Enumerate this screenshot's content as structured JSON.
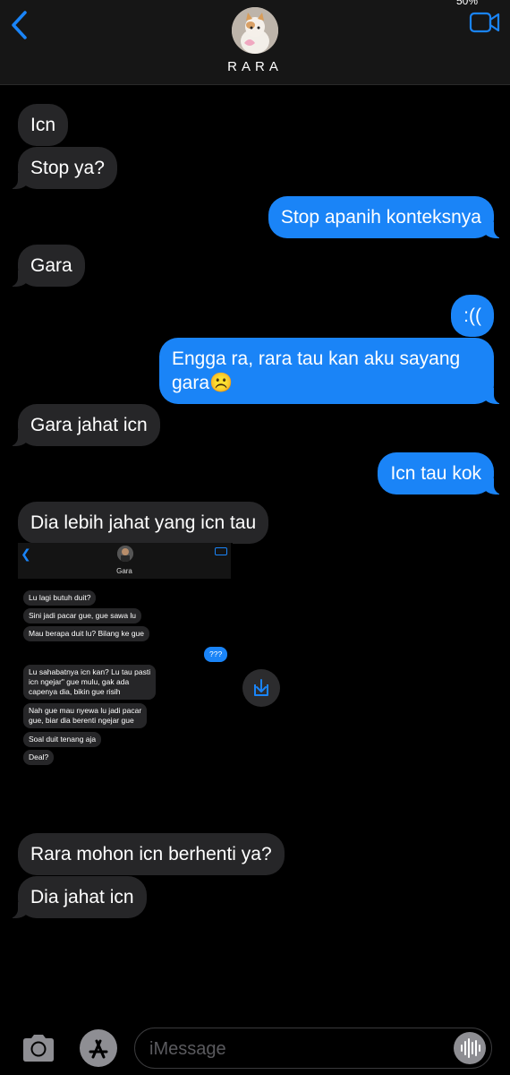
{
  "header": {
    "status_partial": "50%",
    "contact_name": "RARA",
    "back_icon": "chevron-left-icon",
    "video_icon": "video-camera-icon"
  },
  "messages": [
    {
      "dir": "in",
      "text": "Icn"
    },
    {
      "dir": "in",
      "text": "Stop ya?"
    },
    {
      "dir": "out",
      "text": "Stop apanih konteksnya"
    },
    {
      "dir": "in",
      "text": "Gara"
    },
    {
      "dir": "out",
      "text": ":(("
    },
    {
      "dir": "out",
      "text": "Engga ra, rara tau kan aku sayang gara☹️"
    },
    {
      "dir": "in",
      "text": "Gara jahat icn"
    },
    {
      "dir": "out",
      "text": "Icn tau kok"
    },
    {
      "dir": "in",
      "text": "Dia lebih jahat yang icn tau"
    },
    {
      "dir": "in",
      "text": "Rara mohon icn berhenti ya?"
    },
    {
      "dir": "in",
      "text": "Dia jahat icn"
    }
  ],
  "attachment": {
    "contact_name": "Gara",
    "messages": [
      {
        "dir": "in",
        "text": "Lu lagi butuh duit?"
      },
      {
        "dir": "in",
        "text": "Sini jadi pacar gue, gue sawa lu"
      },
      {
        "dir": "in",
        "text": "Mau berapa duit lu? Bilang ke gue"
      },
      {
        "dir": "out",
        "text": "???"
      },
      {
        "dir": "in",
        "line1": "Lu sahabatnya icn kan? Lu tau pasti",
        "line2": "icn ngejar\" gue mulu, gak ada",
        "line3": "capenya dia, bikin gue risih"
      },
      {
        "dir": "in",
        "line1": "Nah gue mau nyewa lu jadi pacar",
        "line2": "gue, biar dia berenti ngejar gue"
      },
      {
        "dir": "in",
        "text": "Soal duit tenang aja"
      },
      {
        "dir": "in",
        "text": "Deal?"
      }
    ],
    "share_icon": "share-arrow-icon"
  },
  "compose": {
    "placeholder": "iMessage",
    "camera_icon": "camera-icon",
    "appstore_icon": "app-store-icon",
    "voice_icon": "voice-waveform-icon"
  },
  "colors": {
    "background": "#000000",
    "incoming_bubble": "#262628",
    "outgoing_bubble": "#1a84f7",
    "header": "#161616"
  }
}
